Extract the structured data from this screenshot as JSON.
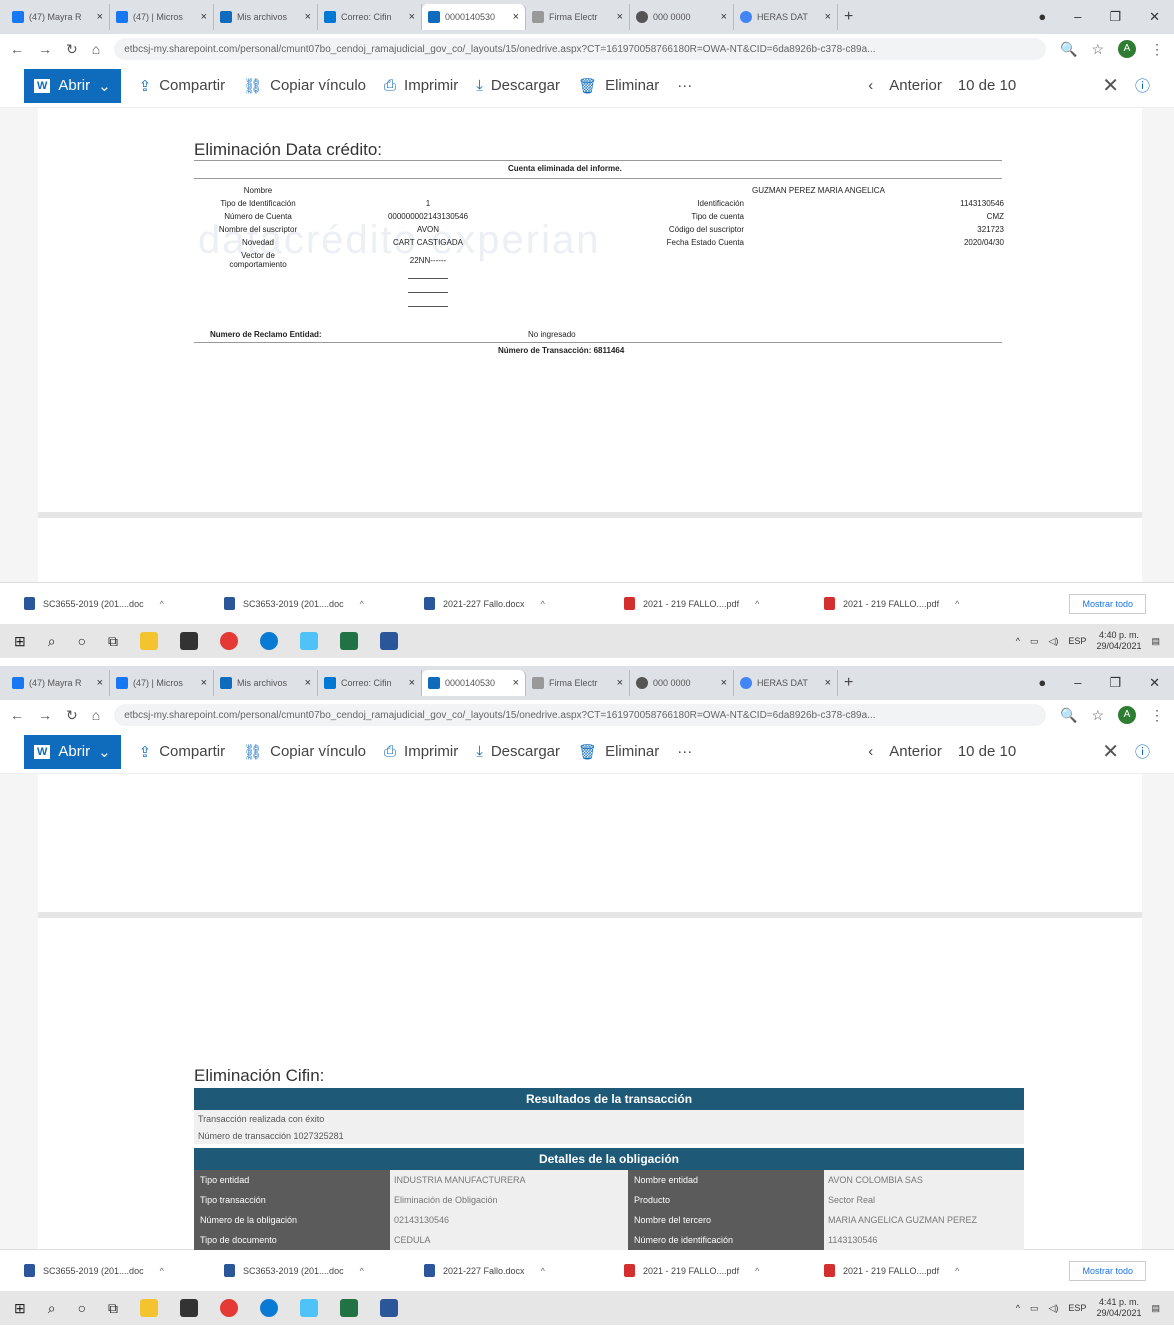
{
  "browser": {
    "tabs": [
      "(47) Mayra R",
      "(47) | Micros",
      "Mis archivos",
      "Correo: Cifin",
      "0000140530",
      "Firma Electr",
      "000 0000",
      "HERAS DAT"
    ],
    "url": "etbcsj-my.sharepoint.com/personal/cmunt07bo_cendoj_ramajudicial_gov_co/_layouts/15/onedrive.aspx?CT=161970058766180R=OWA-NT&CID=6da8926b-c378-c89a...",
    "profile_initial": "A"
  },
  "toolbar": {
    "abrir": "Abrir",
    "compartir": "Compartir",
    "copiar_vinculo": "Copiar vínculo",
    "imprimir": "Imprimir",
    "descargar": "Descargar",
    "eliminar": "Eliminar",
    "more": "···",
    "anterior": "Anterior",
    "counter": "10 de 10"
  },
  "datacredito": {
    "heading": "Eliminación Data crédito:",
    "banner": "Cuenta eliminada del informe.",
    "watermark": "datacrédito experian",
    "rows": [
      {
        "l": "Nombre",
        "v": "",
        "l2": "",
        "v2": "GUZMAN PEREZ MARIA ANGELICA"
      },
      {
        "l": "Tipo de Identificación",
        "v": "1",
        "l2": "Identificación",
        "v2": "1143130546"
      },
      {
        "l": "Número de Cuenta",
        "v": "000000002143130546",
        "l2": "Tipo de cuenta",
        "v2": "CMZ"
      },
      {
        "l": "Nombre del suscriptor",
        "v": "AVON",
        "l2": "Código del suscriptor",
        "v2": "321723"
      },
      {
        "l": "Novedad",
        "v": "CART CASTIGADA",
        "l2": "Fecha Estado Cuenta",
        "v2": "2020/04/30"
      },
      {
        "l": "Vector de comportamiento",
        "v": "22NN------",
        "l2": "",
        "v2": ""
      }
    ],
    "reclamo_label": "Numero de Reclamo Entidad:",
    "reclamo_value": "No ingresado",
    "transaccion": "Número de Transacción: 6811464"
  },
  "cifin": {
    "heading": "Eliminación Cifin:",
    "result_header": "Resultados de la transacción",
    "result_lines": [
      "Transacción realizada con éxito",
      "Número de transacción 1027325281"
    ],
    "details_header": "Detalles de la obligación",
    "rows": [
      {
        "l1": "Tipo entidad",
        "v1": "INDUSTRIA MANUFACTURERA",
        "l2": "Nombre entidad",
        "v2": "AVON COLOMBIA SAS"
      },
      {
        "l1": "Tipo transacción",
        "v1": "Eliminación de Obligación",
        "l2": "Producto",
        "v2": "Sector Real"
      },
      {
        "l1": "Número de la obligación",
        "v1": "02143130546",
        "l2": "Nombre del tercero",
        "v2": "MARIA ANGELICA GUZMAN PEREZ"
      },
      {
        "l1": "Tipo de documento",
        "v1": "CEDULA",
        "l2": "Número de identificación",
        "v2": "1143130546"
      }
    ]
  },
  "downloads": {
    "items": [
      "SC3655-2019 (201....doc",
      "SC3653-2019 (201....doc",
      "2021-227 Fallo.docx",
      "2021 - 219 FALLO....pdf",
      "2021 - 219 FALLO....pdf"
    ],
    "show_all": "Mostrar todo"
  },
  "taskbar": {
    "lang": "ESP",
    "time_top": "4:40 p. m.",
    "time_bottom": "4:41 p. m.",
    "date": "29/04/2021"
  }
}
